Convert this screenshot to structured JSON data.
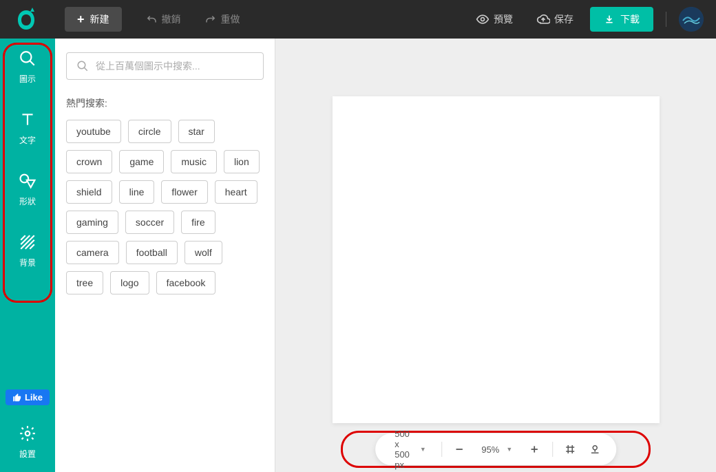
{
  "topbar": {
    "new_label": "新建",
    "undo_label": "撤銷",
    "redo_label": "重做",
    "preview_label": "預覽",
    "save_label": "保存",
    "download_label": "下載"
  },
  "rail": {
    "items": [
      {
        "label": "圖示",
        "icon": "search"
      },
      {
        "label": "文字",
        "icon": "text"
      },
      {
        "label": "形狀",
        "icon": "shape"
      },
      {
        "label": "背景",
        "icon": "hatch"
      }
    ],
    "like_label": "Like",
    "settings_label": "設置"
  },
  "panel": {
    "search_placeholder": "從上百萬個圖示中搜索...",
    "hot_label": "熱門搜索:",
    "tags": [
      "youtube",
      "circle",
      "star",
      "crown",
      "game",
      "music",
      "lion",
      "shield",
      "line",
      "flower",
      "heart",
      "gaming",
      "soccer",
      "fire",
      "camera",
      "football",
      "wolf",
      "tree",
      "logo",
      "facebook"
    ]
  },
  "canvas": {
    "size_label": "500 x 500 px",
    "zoom_label": "95%"
  }
}
